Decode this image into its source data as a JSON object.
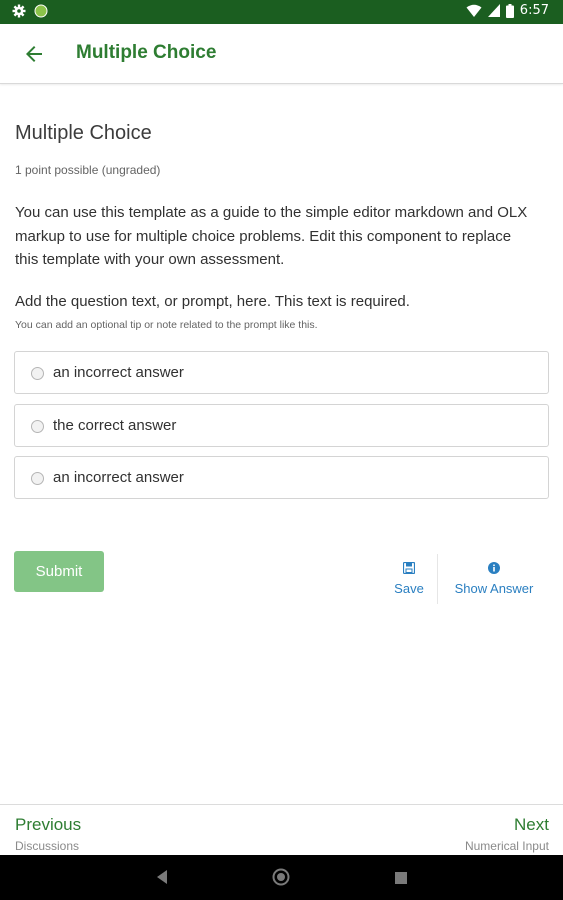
{
  "status_bar": {
    "time": "6:57",
    "icons": [
      "gear-icon",
      "circle-icon",
      "wifi-icon",
      "signal-icon",
      "battery-icon"
    ]
  },
  "header": {
    "title": "Multiple Choice",
    "back_icon": "arrow-left-icon"
  },
  "problem": {
    "title": "Multiple Choice",
    "points": "1 point possible (ungraded)",
    "intro": "You can use this template as a guide to the simple editor markdown and OLX markup to use for multiple choice problems. Edit this component to replace this template with your own assessment.",
    "prompt": "Add the question text, or prompt, here. This text is required.",
    "tip": "You can add an optional tip or note related to the prompt like this.",
    "choices": [
      {
        "label": "an incorrect answer"
      },
      {
        "label": "the correct answer"
      },
      {
        "label": "an incorrect answer"
      }
    ]
  },
  "actions": {
    "submit": "Submit",
    "save": "Save",
    "show_answer": "Show Answer"
  },
  "footer": {
    "previous": {
      "label": "Previous",
      "sub": "Discussions"
    },
    "next": {
      "label": "Next",
      "sub": "Numerical Input"
    }
  },
  "colors": {
    "status_bar": "#1b5e20",
    "brand": "#2e7d32",
    "submit_bg": "#83c586",
    "link": "#2a7fc1"
  }
}
